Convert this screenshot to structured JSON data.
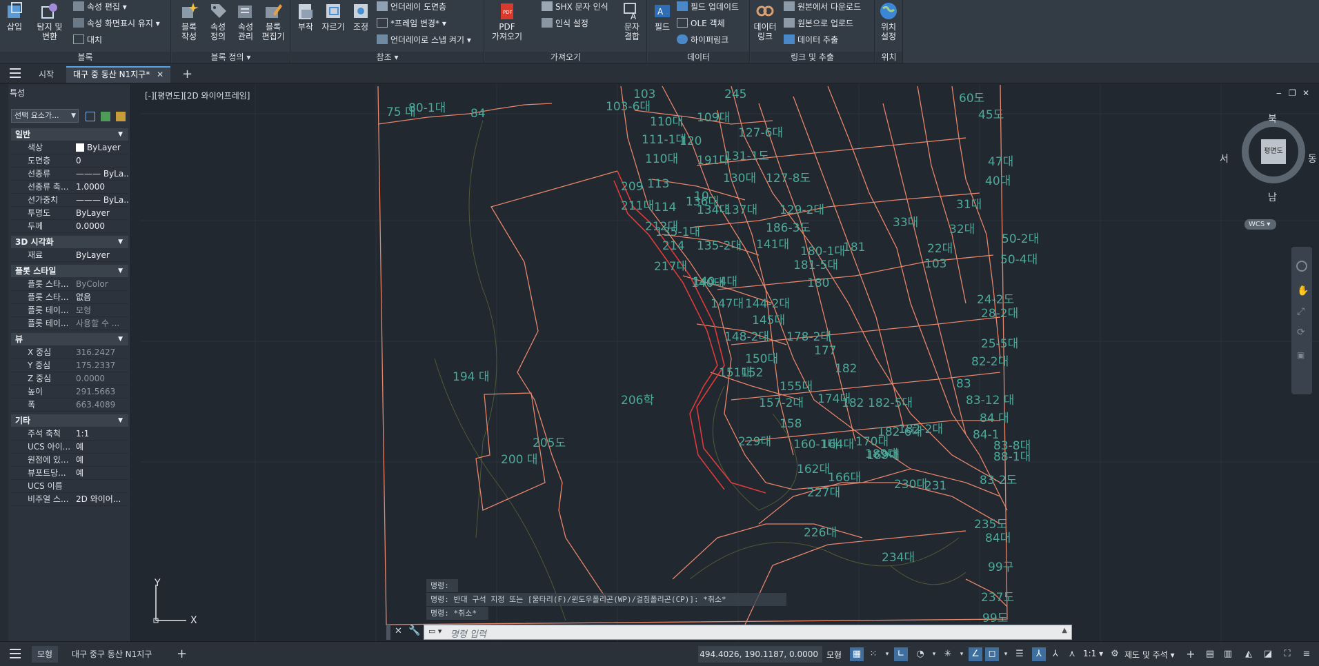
{
  "ribbon": {
    "panels": {
      "block": "블록",
      "block_def": "블록 정의",
      "reference": "참조",
      "import": "가져오기",
      "data": "데이터",
      "link_extract": "링크 및 추출",
      "location": "위치"
    },
    "insert": "삽입",
    "detach_change": [
      "탐지 및",
      "변환"
    ],
    "attr_edit": "속성 편집",
    "attr_display": "속성 화면표시 유지",
    "replace": "대치",
    "block_create": [
      "블록",
      "작성"
    ],
    "attr_define": [
      "속성",
      "정의"
    ],
    "attr_manage": [
      "속성",
      "관리"
    ],
    "block_editor": [
      "블록",
      "편집기"
    ],
    "attach": "부착",
    "clip": "자르기",
    "adjust": "조정",
    "underlay_layers": "언더레이 도면층",
    "frame_change": "*프레임 변경*",
    "underlay_snap": "언더레이로 스냅 켜기",
    "pdf_import": [
      "PDF",
      "가져오기"
    ],
    "shx_recognize": "SHX 문자 인식",
    "recognize_settings": "인식 설정",
    "text_combine": [
      "문자",
      "결합"
    ],
    "field": "필드",
    "field_update": "필드 업데이트",
    "ole_object": "OLE 객체",
    "hyperlink": "하이퍼링크",
    "data_link": [
      "데이터",
      "링크"
    ],
    "download_source": "원본에서 다운로드",
    "upload_source": "원본으로 업로드",
    "data_extract": "데이터 추출",
    "location_settings": [
      "위치",
      "설정"
    ]
  },
  "tabs": {
    "start": "시작",
    "drawing": "대구 중 동산 N1지구*"
  },
  "props": {
    "title": "특성",
    "selection": "선택 요소가...",
    "sections": {
      "general": "일반",
      "vis3d": "3D 시각화",
      "plot": "플롯 스타일",
      "view": "뷰",
      "misc": "기타"
    },
    "general": [
      {
        "k": "색상",
        "v": "ByLayer"
      },
      {
        "k": "도면층",
        "v": "0"
      },
      {
        "k": "선종류",
        "v": "——— ByLa..."
      },
      {
        "k": "선종류 축...",
        "v": "1.0000"
      },
      {
        "k": "선가중치",
        "v": "——— ByLa..."
      },
      {
        "k": "투명도",
        "v": "ByLayer"
      },
      {
        "k": "두께",
        "v": "0.0000"
      }
    ],
    "vis3d": [
      {
        "k": "재료",
        "v": "ByLayer"
      }
    ],
    "plot": [
      {
        "k": "플롯 스타...",
        "v": "ByColor"
      },
      {
        "k": "플롯 스타...",
        "v": "없음"
      },
      {
        "k": "플롯 테이...",
        "v": "모형"
      },
      {
        "k": "플롯 테이...",
        "v": "사용할 수 ..."
      }
    ],
    "view": [
      {
        "k": "X 중심",
        "v": "316.2427"
      },
      {
        "k": "Y 중심",
        "v": "175.2337"
      },
      {
        "k": "Z 중심",
        "v": "0.0000"
      },
      {
        "k": "높이",
        "v": "291.5663"
      },
      {
        "k": "폭",
        "v": "663.4089"
      }
    ],
    "misc": [
      {
        "k": "주석 축척",
        "v": "1:1"
      },
      {
        "k": "UCS 아이...",
        "v": "예"
      },
      {
        "k": "원점에 있...",
        "v": "예"
      },
      {
        "k": "뷰포트당...",
        "v": "예"
      },
      {
        "k": "UCS 이름",
        "v": ""
      },
      {
        "k": "비주얼 스...",
        "v": "2D 와이어..."
      }
    ]
  },
  "viewport": {
    "label": "[-][평면도][2D 와이어프레임]",
    "viewcube": {
      "face": "평면도",
      "n": "북",
      "s": "남",
      "e": "동",
      "w": "서",
      "wcs": "WCS"
    },
    "ucs_x": "X",
    "ucs_y": "Y"
  },
  "parcels": [
    "75 대",
    "80-1대",
    "84",
    "103",
    "103-6대",
    "245",
    "110대",
    "109대",
    "127-6대",
    "110대",
    "111-1대",
    "120",
    "191대",
    "131-1도",
    "130대",
    "127-8도",
    "209",
    "113",
    "10",
    "211대",
    "114",
    "136대",
    "134대",
    "129-2대",
    "137대",
    "186-3도",
    "212대",
    "135-1대",
    "214",
    "135-2대",
    "141대",
    "180-1대",
    "217대",
    "140대",
    "140-4대",
    "147대",
    "144-2대",
    "181-5대",
    "180",
    "145대",
    "148-2대",
    "150대",
    "178-2대",
    "177",
    "182",
    "151대",
    "152",
    "155대",
    "157-2대",
    "174대",
    "158",
    "160-1대",
    "162대",
    "164대",
    "166대",
    "227대",
    "226대",
    "234대",
    "194 대",
    "206학",
    "205도",
    "200 대",
    "229대",
    "60도",
    "45도",
    "47대",
    "40대",
    "31대",
    "50-2대",
    "50-4대",
    "32대",
    "33대",
    "103",
    "22대",
    "24-2도",
    "28-2대",
    "25-5대",
    "82-2대",
    "83",
    "83-12 대",
    "84 대",
    "84-1",
    "83-8대",
    "88-1대",
    "83-2도",
    "235도",
    "84대",
    "99구",
    "237도",
    "99도",
    "181",
    "182-5대",
    "182-6대",
    "170대",
    "182",
    "182-2대",
    "230대",
    "231",
    "189대",
    "169대"
  ],
  "command": {
    "history": [
      "명령:",
      "명령: 반대 구석 지정 또는 [울타리(F)/윈도우폴리곤(WP)/걸침폴리곤(CP)]: *취소*",
      "명령: *취소*"
    ],
    "placeholder": "명령 입력"
  },
  "status": {
    "model_tab": "모형",
    "layout_tab": "대구 중구 동산 N1지구",
    "coords": "494.4026, 190.1187, 0.0000",
    "model": "모형",
    "scale": "1:1",
    "workspace": "제도 및 주석"
  },
  "colors": {
    "background": "#212830",
    "parcel_line": "#e8856a",
    "red_line": "#e03a3a",
    "label": "#4fa89a",
    "contour": "#555f3a",
    "accent": "#57a5e6"
  }
}
